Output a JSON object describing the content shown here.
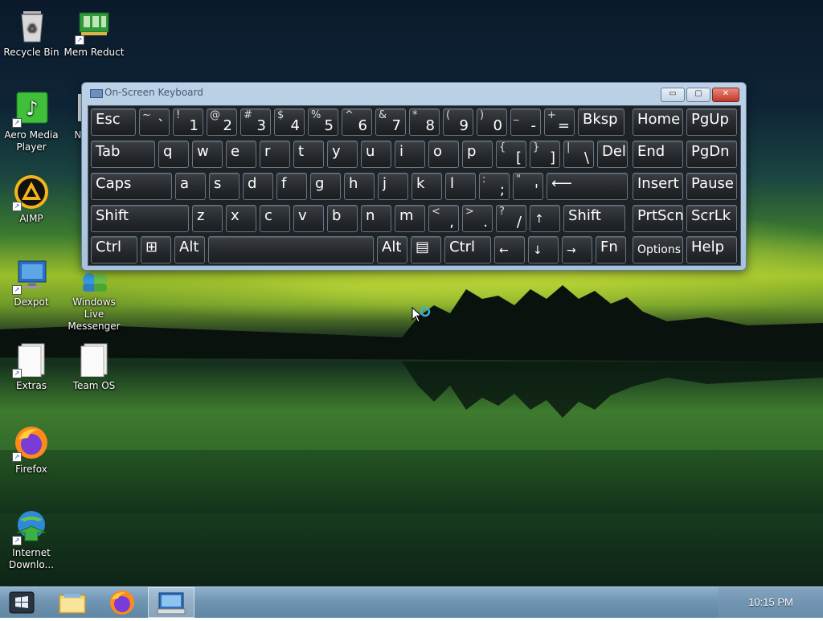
{
  "desktop": {
    "icons": [
      {
        "label": "Recycle Bin",
        "icon": "recycle-bin-icon"
      },
      {
        "label": "Mem Reduct",
        "icon": "memory-icon"
      },
      {
        "label": "Aero Media Player",
        "icon": "music-note-icon"
      },
      {
        "label": "Nc",
        "icon": "app-icon"
      },
      {
        "label": "AIMP",
        "icon": "aimp-icon"
      },
      {
        "label": "Dexpot",
        "icon": "monitor-icon"
      },
      {
        "label": "Windows Live Messenger",
        "icon": "messenger-icon"
      },
      {
        "label": "Extras",
        "icon": "folder-icon"
      },
      {
        "label": "Team OS",
        "icon": "folder-icon"
      },
      {
        "label": "Firefox",
        "icon": "firefox-icon"
      },
      {
        "label": "Internet Downlo...",
        "icon": "download-manager-icon"
      }
    ]
  },
  "osk": {
    "title": "On-Screen Keyboard",
    "controls": {
      "minimize": "▭",
      "restore": "▢",
      "close": "✕"
    },
    "rows": [
      [
        {
          "t": "Esc"
        },
        {
          "s": "~",
          "m": "`"
        },
        {
          "s": "!",
          "m": "1"
        },
        {
          "s": "@",
          "m": "2"
        },
        {
          "s": "#",
          "m": "3"
        },
        {
          "s": "$",
          "m": "4"
        },
        {
          "s": "%",
          "m": "5"
        },
        {
          "s": "^",
          "m": "6"
        },
        {
          "s": "&",
          "m": "7"
        },
        {
          "s": "*",
          "m": "8"
        },
        {
          "s": "(",
          "m": "9"
        },
        {
          "s": ")",
          "m": "0"
        },
        {
          "s": "_",
          "m": "-"
        },
        {
          "s": "+",
          "m": "="
        },
        {
          "t": "Bksp"
        }
      ],
      [
        {
          "t": "Tab"
        },
        {
          "t": "q"
        },
        {
          "t": "w"
        },
        {
          "t": "e"
        },
        {
          "t": "r"
        },
        {
          "t": "t"
        },
        {
          "t": "y"
        },
        {
          "t": "u"
        },
        {
          "t": "i"
        },
        {
          "t": "o"
        },
        {
          "t": "p"
        },
        {
          "s": "{",
          "m": "["
        },
        {
          "s": "}",
          "m": "]"
        },
        {
          "s": "|",
          "m": "\\"
        },
        {
          "t": "Del"
        }
      ],
      [
        {
          "t": "Caps"
        },
        {
          "t": "a"
        },
        {
          "t": "s"
        },
        {
          "t": "d"
        },
        {
          "t": "f"
        },
        {
          "t": "g"
        },
        {
          "t": "h"
        },
        {
          "t": "j"
        },
        {
          "t": "k"
        },
        {
          "t": "l"
        },
        {
          "s": ":",
          "m": ";"
        },
        {
          "s": "\"",
          "m": "'"
        },
        {
          "t": "⟵"
        }
      ],
      [
        {
          "t": "Shift"
        },
        {
          "t": "z"
        },
        {
          "t": "x"
        },
        {
          "t": "c"
        },
        {
          "t": "v"
        },
        {
          "t": "b"
        },
        {
          "t": "n"
        },
        {
          "t": "m"
        },
        {
          "s": "<",
          "m": ","
        },
        {
          "s": ">",
          "m": "."
        },
        {
          "s": "?",
          "m": "/"
        },
        {
          "t": "↑"
        },
        {
          "t": "Shift"
        }
      ],
      [
        {
          "t": "Ctrl"
        },
        {
          "t": "⊞"
        },
        {
          "t": "Alt"
        },
        {
          "t": ""
        },
        {
          "t": "Alt"
        },
        {
          "t": "▤"
        },
        {
          "t": "Ctrl"
        },
        {
          "t": "←"
        },
        {
          "t": "↓"
        },
        {
          "t": "→"
        },
        {
          "t": "Fn"
        }
      ]
    ],
    "nav": [
      [
        "Home",
        "PgUp"
      ],
      [
        "End",
        "PgDn"
      ],
      [
        "Insert",
        "Pause"
      ],
      [
        "PrtScn",
        "ScrLk"
      ],
      [
        "Options",
        "Help"
      ]
    ]
  },
  "taskbar": {
    "start": "start-orb-icon",
    "pinned": [
      "file-explorer-icon",
      "firefox-icon",
      "on-screen-keyboard-icon"
    ],
    "clock": "10:15 PM"
  }
}
